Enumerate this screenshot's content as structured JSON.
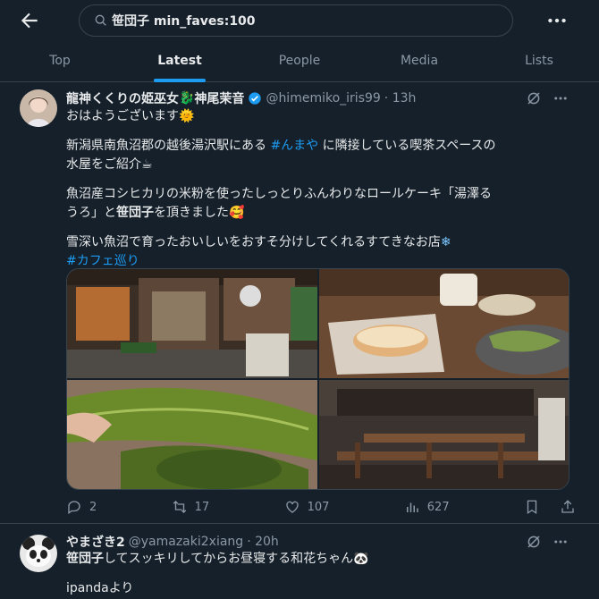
{
  "header": {
    "search_query": "笹団子 min_faves:100",
    "tabs": [
      {
        "label": "Top"
      },
      {
        "label": "Latest"
      },
      {
        "label": "People"
      },
      {
        "label": "Media"
      },
      {
        "label": "Lists"
      }
    ],
    "active_tab": "Latest"
  },
  "tweets": [
    {
      "name": "龍神くくりの姫巫女",
      "name_emoji": "🐉",
      "name_suffix": "神尾茉音",
      "handle": "@himemiko_iris99",
      "time": "· 13h",
      "line1": "おはようございます",
      "line1_emoji": "🌞",
      "line2a": "新潟県南魚沼郡の越後湯沢駅にある",
      "line2_hashtag": "#んまや",
      "line2b": "に隣接している喫茶スペースの",
      "line3": "水屋をご紹介",
      "line3_emoji": "☕",
      "line4": "魚沼産コシヒカリの米粉を使ったしっとりふんわりなロールケーキ「湯澤る",
      "line5a": "うろ」と",
      "line5_bold": "笹団子",
      "line5b": "を頂きました",
      "line5_emoji": "🥰",
      "line6": "雪深い魚沼で育ったおいしいをおすそ分けしてくれるすてきなお店",
      "line6_emoji": "❄",
      "line7_hashtag": "#カフェ巡り",
      "stats": {
        "replies": "2",
        "reposts": "17",
        "likes": "107",
        "views": "627"
      },
      "icons": [
        "reply-icon",
        "repost-icon",
        "like-icon",
        "views-icon",
        "bookmark-icon",
        "share-icon"
      ]
    },
    {
      "name": "やまざき2",
      "handle": "@yamazaki2xiang",
      "time": "· 20h",
      "line1_bold": "笹団子",
      "line1": "してスッキリしてからお昼寝する和花ちゃん",
      "line1_emoji": "🐼",
      "line2": "ipandaより"
    }
  ],
  "colors": {
    "background": "#15202b",
    "accent": "#1d9bf0",
    "muted": "#8b98a5",
    "border": "#38444d"
  }
}
